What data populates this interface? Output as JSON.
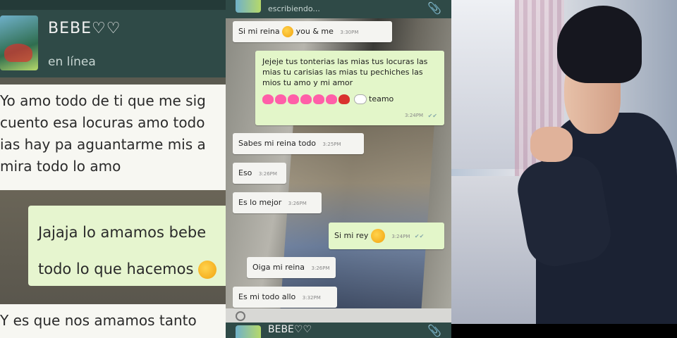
{
  "left": {
    "contact_name": "BEBE♡♡",
    "status": "en línea",
    "msg1_lines": [
      "Yo amo todo de ti que me sig",
      "cuento esa locuras amo todo",
      "ias hay pa aguantarme mis a",
      "mira todo lo amo"
    ],
    "msg2_lines": [
      "Jajaja lo amamos bebe",
      "todo lo que hacemos"
    ],
    "msg3": "Y es que nos amamos tanto"
  },
  "middle": {
    "typing": "escribiendo...",
    "messages": [
      {
        "text": "Si mi reina",
        "extra": "you & me",
        "time": "3:30PM",
        "dir": "in"
      },
      {
        "text": "Jejeje tus tonterias las mias tus locuras las mias tu carisias las mias tu pechiches las mios tu amo y mi amor",
        "extra": "teamo",
        "time": "3:24PM",
        "dir": "out"
      },
      {
        "text": "Sabes mi reina todo",
        "time": "3:25PM",
        "dir": "in"
      },
      {
        "text": "Eso",
        "time": "3:26PM",
        "dir": "in"
      },
      {
        "text": "Es lo mejor",
        "time": "3:26PM",
        "dir": "in"
      },
      {
        "text": "Si mi rey",
        "time": "3:24PM",
        "dir": "out"
      },
      {
        "text": "Oiga mi reina",
        "time": "3:26PM",
        "dir": "in"
      },
      {
        "text": "Es mi todo allo",
        "time": "3:32PM",
        "dir": "in"
      }
    ],
    "bottom_name": "BEBE♡♡"
  },
  "colors": {
    "header": "#2f4a47",
    "incoming_bubble": "#f4f4f1",
    "outgoing_bubble": "#e3f6c9"
  }
}
